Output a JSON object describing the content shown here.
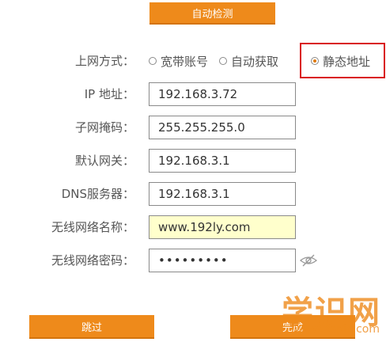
{
  "top_button": {
    "label": "自动检测"
  },
  "connection_type": {
    "label": "上网方式：",
    "options": [
      {
        "label": "宽带账号",
        "selected": false
      },
      {
        "label": "自动获取",
        "selected": false
      },
      {
        "label": "静态地址",
        "selected": true
      }
    ]
  },
  "fields": {
    "ip": {
      "label": "IP 地址：",
      "value": "192.168.3.72"
    },
    "subnet": {
      "label": "子网掩码：",
      "value": "255.255.255.0"
    },
    "gateway": {
      "label": "默认网关：",
      "value": "192.168.3.1"
    },
    "dns": {
      "label": "DNS服务器：",
      "value": "192.168.3.1"
    },
    "ssid": {
      "label": "无线网络名称：",
      "value": "www.192ly.com"
    },
    "wifi_password": {
      "label": "无线网络密码：",
      "value": "•••••••••"
    }
  },
  "bottom_buttons": {
    "skip": "跳过",
    "finish": "完成"
  },
  "watermark": {
    "main": "学识网",
    "sub": "www.xspic.com"
  },
  "colors": {
    "accent": "#ee8a1b",
    "highlight_box": "#d9151b",
    "ssid_background": "#ffffcc"
  }
}
